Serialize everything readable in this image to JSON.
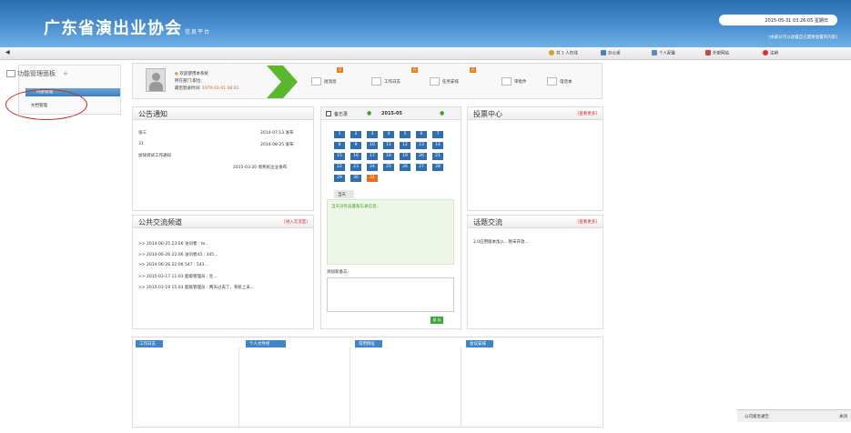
{
  "header": {
    "title": "广东省演出业协会",
    "subtitle": "信息平台",
    "datetime": "2015-05-31 03:26:05 星期日",
    "notice": "[本部分可以放置自己需要放置的内容]"
  },
  "toolbar": {
    "online": "共 1 人在线",
    "office": "办公桌",
    "personal": "个人配置",
    "sites": "外部网站",
    "logout": "注销"
  },
  "sidebar": {
    "head": "功能管理面板",
    "selected": "内部管理",
    "doc": "文档管理"
  },
  "user": {
    "welcome": "欢迎使用本系统",
    "dept": "所在部门:职位:",
    "last_label": "最后登录时间:",
    "last_time": "1970-01-01 08:01",
    "q1": "短消息",
    "q2": "工作日志",
    "q3": "任务安排",
    "q4": "审批件",
    "q5": "电话本",
    "b1": "0",
    "b2": "0",
    "b3": "0"
  },
  "notice_panel": {
    "title": "公告通知",
    "rows": [
      {
        "a": "张三",
        "b": "2014-07-13 发布"
      },
      {
        "a": "31",
        "b": "2014-08-25 发布"
      },
      {
        "a": "加快调试工作通知",
        "b": ""
      },
      {
        "a": "",
        "b": "2015-03-20 周燕彤企业发布"
      }
    ]
  },
  "calendar": {
    "label": "备忘录",
    "month": "2015-05",
    "today_tab": "当天",
    "empty_msg": "当天没有设置备忘录信息...",
    "add_label": "添加新备忘:",
    "save": "保 存",
    "days": [
      "1",
      "2",
      "3",
      "4",
      "5",
      "6",
      "7",
      "8",
      "9",
      "10",
      "11",
      "12",
      "13",
      "14",
      "15",
      "16",
      "17",
      "18",
      "19",
      "20",
      "21",
      "22",
      "23",
      "24",
      "25",
      "26",
      "27",
      "28",
      "29",
      "30",
      "31"
    ]
  },
  "vote": {
    "title": "投票中心",
    "more": "[查看更多]"
  },
  "chat": {
    "title": "公共交流频道",
    "more": "[进入交流室]",
    "rows": [
      ">> 2014-06-25 23:06  访问者 : te...",
      ">> 2014-06-26 22:06  访问者45 : 345...",
      ">> 2014-06-26 22:06  547 : 543...",
      ">> 2015-03-17 11:03  超级管理员 : 吐...",
      ">> 2015-03-19 15:03  超级管理员 : 两天过去了，系统上未..."
    ]
  },
  "topic": {
    "title": "话题交流",
    "more": "[查看更多]",
    "row": "2.0应用版本加入...暂未开放..."
  },
  "tabs": {
    "t1": "工作日志",
    "t2": "个人文件柜",
    "t3": "常用网址",
    "t4": "会议安排"
  },
  "footer": {
    "alert": "公司紧急通告",
    "close": "关闭"
  }
}
